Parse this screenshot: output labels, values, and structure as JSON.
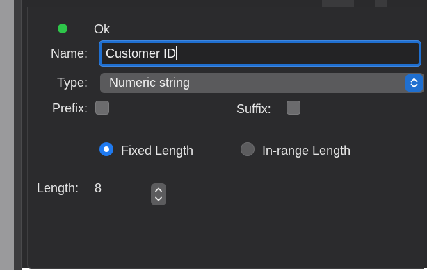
{
  "status": {
    "text": "Ok",
    "color": "#2ec64a"
  },
  "name": {
    "label": "Name:",
    "value": "Customer ID"
  },
  "type": {
    "label": "Type:",
    "selected": "Numeric string"
  },
  "prefix": {
    "label": "Prefix:",
    "checked": false
  },
  "suffix": {
    "label": "Suffix:",
    "checked": false
  },
  "length_mode": {
    "options": [
      {
        "label": "Fixed Length",
        "selected": true
      },
      {
        "label": "In-range Length",
        "selected": false
      }
    ]
  },
  "length": {
    "label": "Length:",
    "value": "8"
  },
  "colors": {
    "accent": "#1f6fd0",
    "panel_bg": "#2a2a2c",
    "text": "#e6e6e6"
  }
}
